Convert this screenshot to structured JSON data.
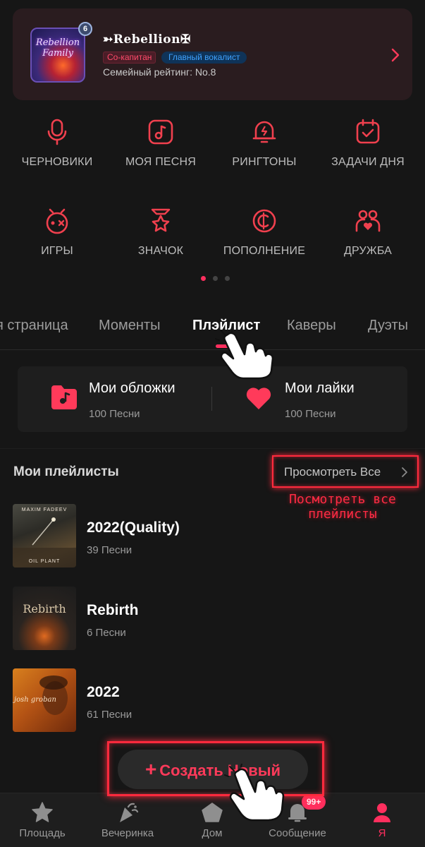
{
  "family": {
    "logo_text": "Rebellion Family",
    "level": "6",
    "name": "➳Rebellion✠",
    "role_badge": "Со-капитан",
    "position_badge": "Главный вокалист",
    "rating": "Семейный рейтинг: No.8"
  },
  "grid": {
    "items": [
      {
        "label": "ЧЕРНОВИКИ",
        "icon": "microphone-icon"
      },
      {
        "label": "МОЯ ПЕСНЯ",
        "icon": "music-note-icon"
      },
      {
        "label": "РИНГТОНЫ",
        "icon": "bell-icon"
      },
      {
        "label": "ЗАДАЧИ ДНЯ",
        "icon": "calendar-check-icon"
      },
      {
        "label": "ИГРЫ",
        "icon": "game-icon"
      },
      {
        "label": "ЗНАЧОК",
        "icon": "star-badge-icon"
      },
      {
        "label": "ПОПОЛНЕНИЕ",
        "icon": "coin-icon"
      },
      {
        "label": "ДРУЖБА",
        "icon": "friends-icon"
      }
    ],
    "page_dots": 3,
    "active_page": 1
  },
  "tabs": {
    "items": [
      "я страница",
      "Моменты",
      "Плэйлист",
      "Каверы",
      "Дуэты"
    ],
    "active": "Плэйлист"
  },
  "library": {
    "covers": {
      "title": "Мои обложки",
      "count": "100 Песни"
    },
    "likes": {
      "title": "Мои лайки",
      "count": "100 Песни"
    }
  },
  "playlists": {
    "heading": "Мои плейлисты",
    "view_all": "Просмотреть Все",
    "annotation": "Посмотреть все плейлисты",
    "items": [
      {
        "title": "2022(Quality)",
        "count": "39 Песни",
        "cover_top": "MAXIM FADEEV",
        "cover_bottom": "OIL PLANT"
      },
      {
        "title": "Rebirth",
        "count": "6 Песни",
        "cover_text": "Rebirth"
      },
      {
        "title": "2022",
        "count": "61 Песни",
        "cover_text": "josh groban"
      }
    ]
  },
  "create": {
    "plus": "+",
    "label": "Создать Новый"
  },
  "nav": {
    "items": [
      {
        "label": "Площадь",
        "icon": "star-icon"
      },
      {
        "label": "Вечеринка",
        "icon": "party-popper-icon"
      },
      {
        "label": "Дом",
        "icon": "home-pentagon-icon"
      },
      {
        "label": "Сообщение",
        "icon": "bell-icon"
      },
      {
        "label": "Я",
        "icon": "profile-icon"
      }
    ],
    "active": "Я",
    "message_badge": "99+"
  },
  "colors": {
    "accent": "#ff2f5e",
    "background": "#161616",
    "highlight_box": "#ff2a3d"
  }
}
